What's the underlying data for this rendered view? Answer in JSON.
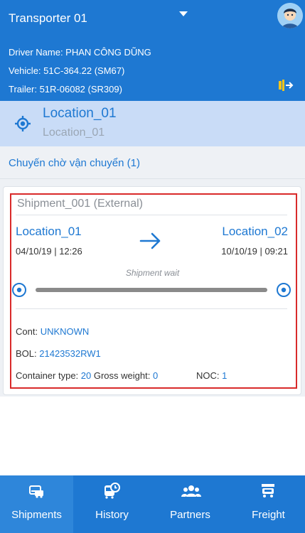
{
  "header": {
    "transporter": "Transporter 01",
    "driver_line": "Driver Name: PHAN CÔNG DŨNG",
    "vehicle_line": "Vehicle: 51C-364.22 (SM67)",
    "trailer_line": "Trailer: 51R-06082 (SR309)"
  },
  "location": {
    "title": "Location_01",
    "subtitle": "Location_01"
  },
  "section": {
    "title": "Chuyến chờ vận chuyển (1)"
  },
  "shipment": {
    "title": "Shipment_001 (External)",
    "from_location": "Location_01",
    "from_time": "04/10/19 | 12:26",
    "to_location": "Location_02",
    "to_time": "10/10/19 | 09:21",
    "status": "Shipment wait",
    "cont_label": "Cont: ",
    "cont_value": "UNKNOWN",
    "bol_label": "BOL: ",
    "bol_value": "21423532RW1",
    "container_type_label": "Container type: ",
    "container_type_value": "20",
    "gross_weight_label": " Gross weight: ",
    "gross_weight_value": "0",
    "noc_label": "NOC: ",
    "noc_value": "1"
  },
  "nav": {
    "items": [
      {
        "label": "Shipments",
        "icon": "car-icon",
        "active": true
      },
      {
        "label": "History",
        "icon": "bus-history-icon",
        "active": false
      },
      {
        "label": "Partners",
        "icon": "people-icon",
        "active": false
      },
      {
        "label": "Freight",
        "icon": "truck-icon",
        "active": false
      }
    ]
  },
  "colors": {
    "primary": "#1e78d2",
    "location_bar": "#c9dcf7",
    "highlight_outline": "#d92a2a"
  }
}
